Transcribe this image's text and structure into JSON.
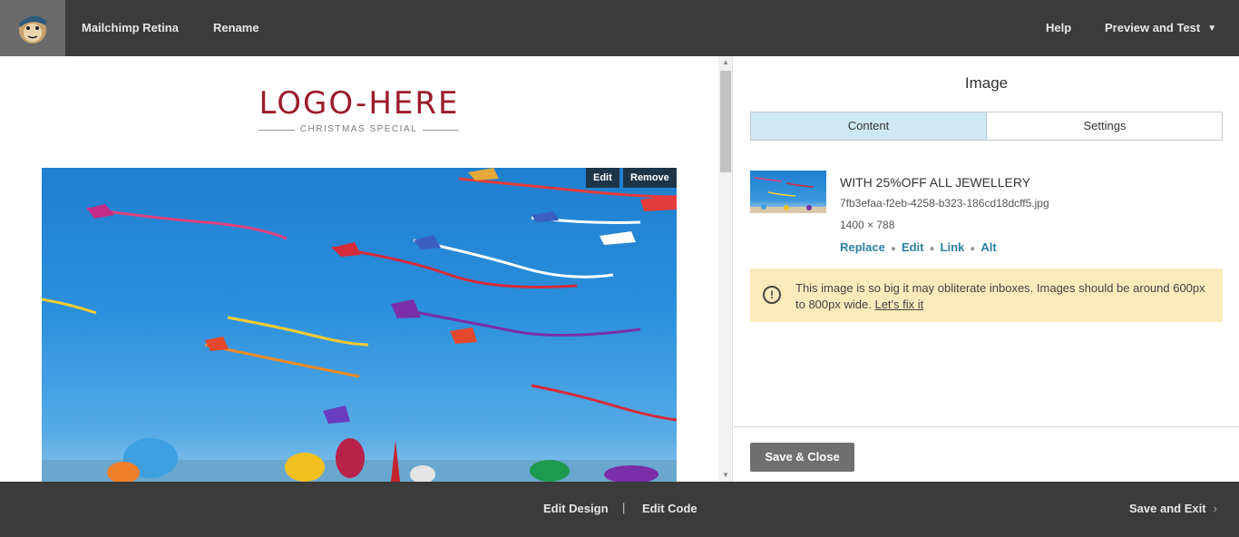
{
  "topbar": {
    "title": "Mailchimp Retina",
    "rename_label": "Rename",
    "help_label": "Help",
    "preview_label": "Preview and Test",
    "logo_icon": "mailchimp-monkey-icon",
    "caret_icon": "chevron-down-icon"
  },
  "canvas": {
    "brand": "LOGO-HERE",
    "tagline": "CHRISTMAS SPECIAL",
    "image_edit_label": "Edit",
    "image_remove_label": "Remove"
  },
  "panel": {
    "title": "Image",
    "tabs": [
      {
        "label": "Content",
        "active": true
      },
      {
        "label": "Settings",
        "active": false
      }
    ],
    "image": {
      "title": "WITH 25%OFF ALL JEWELLERY",
      "filename": "7fb3efaa-f2eb-4258-b323-186cd18dcff5.jpg",
      "dimensions": "1400 × 788",
      "actions": [
        "Replace",
        "Edit",
        "Link",
        "Alt"
      ]
    },
    "warning": {
      "icon": "exclamation-circle-icon",
      "text": "This image is so big it may obliterate inboxes. Images should be around 600px to 800px wide.",
      "link": "Let's fix it"
    },
    "save_close_label": "Save & Close"
  },
  "bottombar": {
    "edit_design_label": "Edit Design",
    "separator": "|",
    "edit_code_label": "Edit Code",
    "save_exit_label": "Save and Exit",
    "chevron_icon": "chevron-right-icon"
  },
  "colors": {
    "bar_bg": "#3b3b3b",
    "brand": "#9b1c2c",
    "active_tab": "#cfe9f4",
    "link": "#2a7fa3",
    "warning_bg": "#fbeaba",
    "save_button": "#6f6f6f"
  }
}
